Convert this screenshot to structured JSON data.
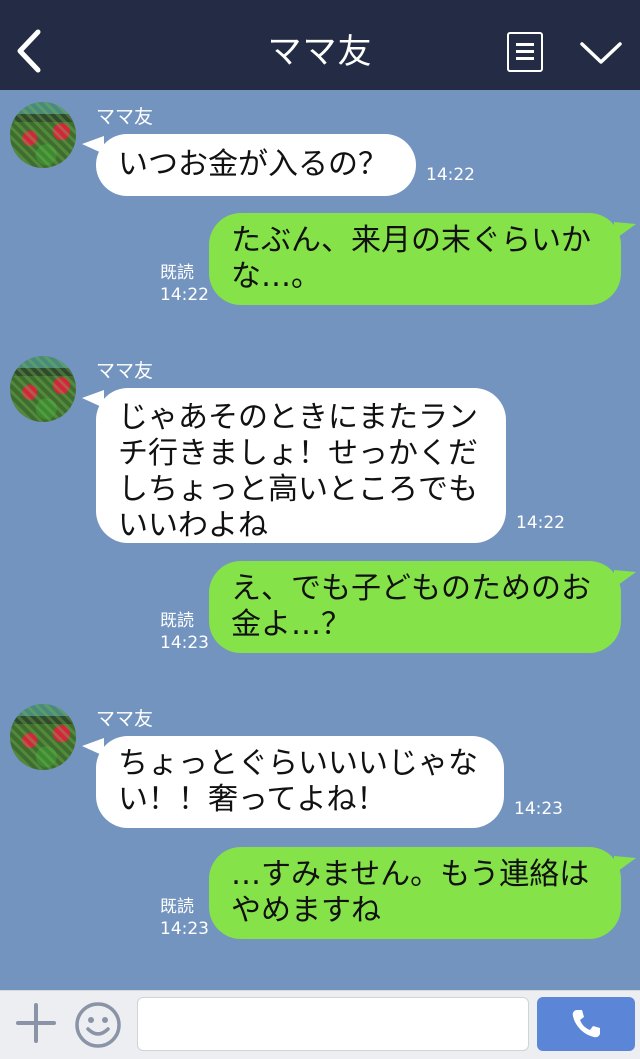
{
  "header": {
    "title": "ママ友",
    "back_icon": "chevron-left-icon",
    "menu_icon": "note-list-icon",
    "expand_icon": "chevron-down-icon"
  },
  "messages": [
    {
      "direction": "in",
      "sender": "ママ友",
      "text": "いつお金が入るの？",
      "time": "14:22"
    },
    {
      "direction": "out",
      "text": "たぶん、来月の末ぐらいかな…。",
      "read": "既読",
      "time": "14:22"
    },
    {
      "direction": "in",
      "sender": "ママ友",
      "text": "じゃあそのときにまたランチ行きましょ！せっかくだしちょっと高いところでもいいわよね",
      "time": "14:22"
    },
    {
      "direction": "out",
      "text": "え、でも子どものためのお金よ…？",
      "read": "既読",
      "time": "14:23"
    },
    {
      "direction": "in",
      "sender": "ママ友",
      "text": "ちょっとぐらいいいじゃない！！奢ってよね！",
      "time": "14:23"
    },
    {
      "direction": "out",
      "text": "…すみません。もう連絡はやめますね",
      "read": "既読",
      "time": "14:23"
    }
  ],
  "footer": {
    "add_icon": "plus-icon",
    "emoji_icon": "smiley-icon",
    "input_value": "",
    "call_icon": "phone-icon"
  },
  "colors": {
    "background": "#7494c0",
    "header": "#232c44",
    "outgoing_bubble": "#85e249",
    "incoming_bubble": "#ffffff",
    "call_button": "#5b86d8"
  }
}
